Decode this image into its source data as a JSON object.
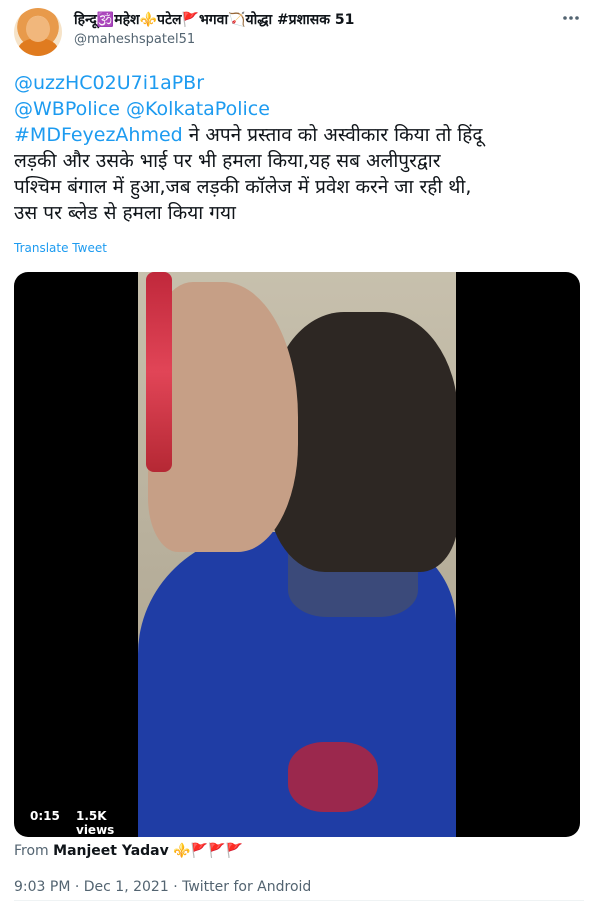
{
  "author": {
    "display_name": "हिन्दू🕉️महेश⚜️पटेल🚩भगवा🏹योद्धा #प्रशासक 51",
    "handle": "@maheshspatel51"
  },
  "tweet": {
    "mention_1": "@uzzHC02U7i1aPBr",
    "mention_2": "@WBPolice",
    "mention_3": "@KolkataPolice",
    "hashtag": "#MDFeyezAhmed",
    "text_line_1": " ने अपने प्रस्ताव को अस्वीकार किया तो हिंदू",
    "text_line_2": "लड़की और उसके भाई पर भी हमला किया,यह सब अलीपुरद्वार",
    "text_line_3": "पश्चिम बंगाल में हुआ,जब लड़की कॉलेज में प्रवेश करने जा रही थी,",
    "text_line_4": "उस पर ब्लेड से हमला किया गया",
    "translate_label": "Translate Tweet"
  },
  "video": {
    "duration": "0:15",
    "views": "1.5K views"
  },
  "attribution": {
    "prefix": "From ",
    "source_name": "Manjeet Yadav",
    "emojis": "⚜️🚩🚩🚩"
  },
  "meta": {
    "time_date_client": "9:03 PM · Dec 1, 2021 · Twitter for Android"
  },
  "colors": {
    "link": "#1d9bf0",
    "secondary_text": "#536471",
    "primary_text": "#0f1419"
  },
  "icons": {
    "more": "more-horizontal-icon"
  }
}
